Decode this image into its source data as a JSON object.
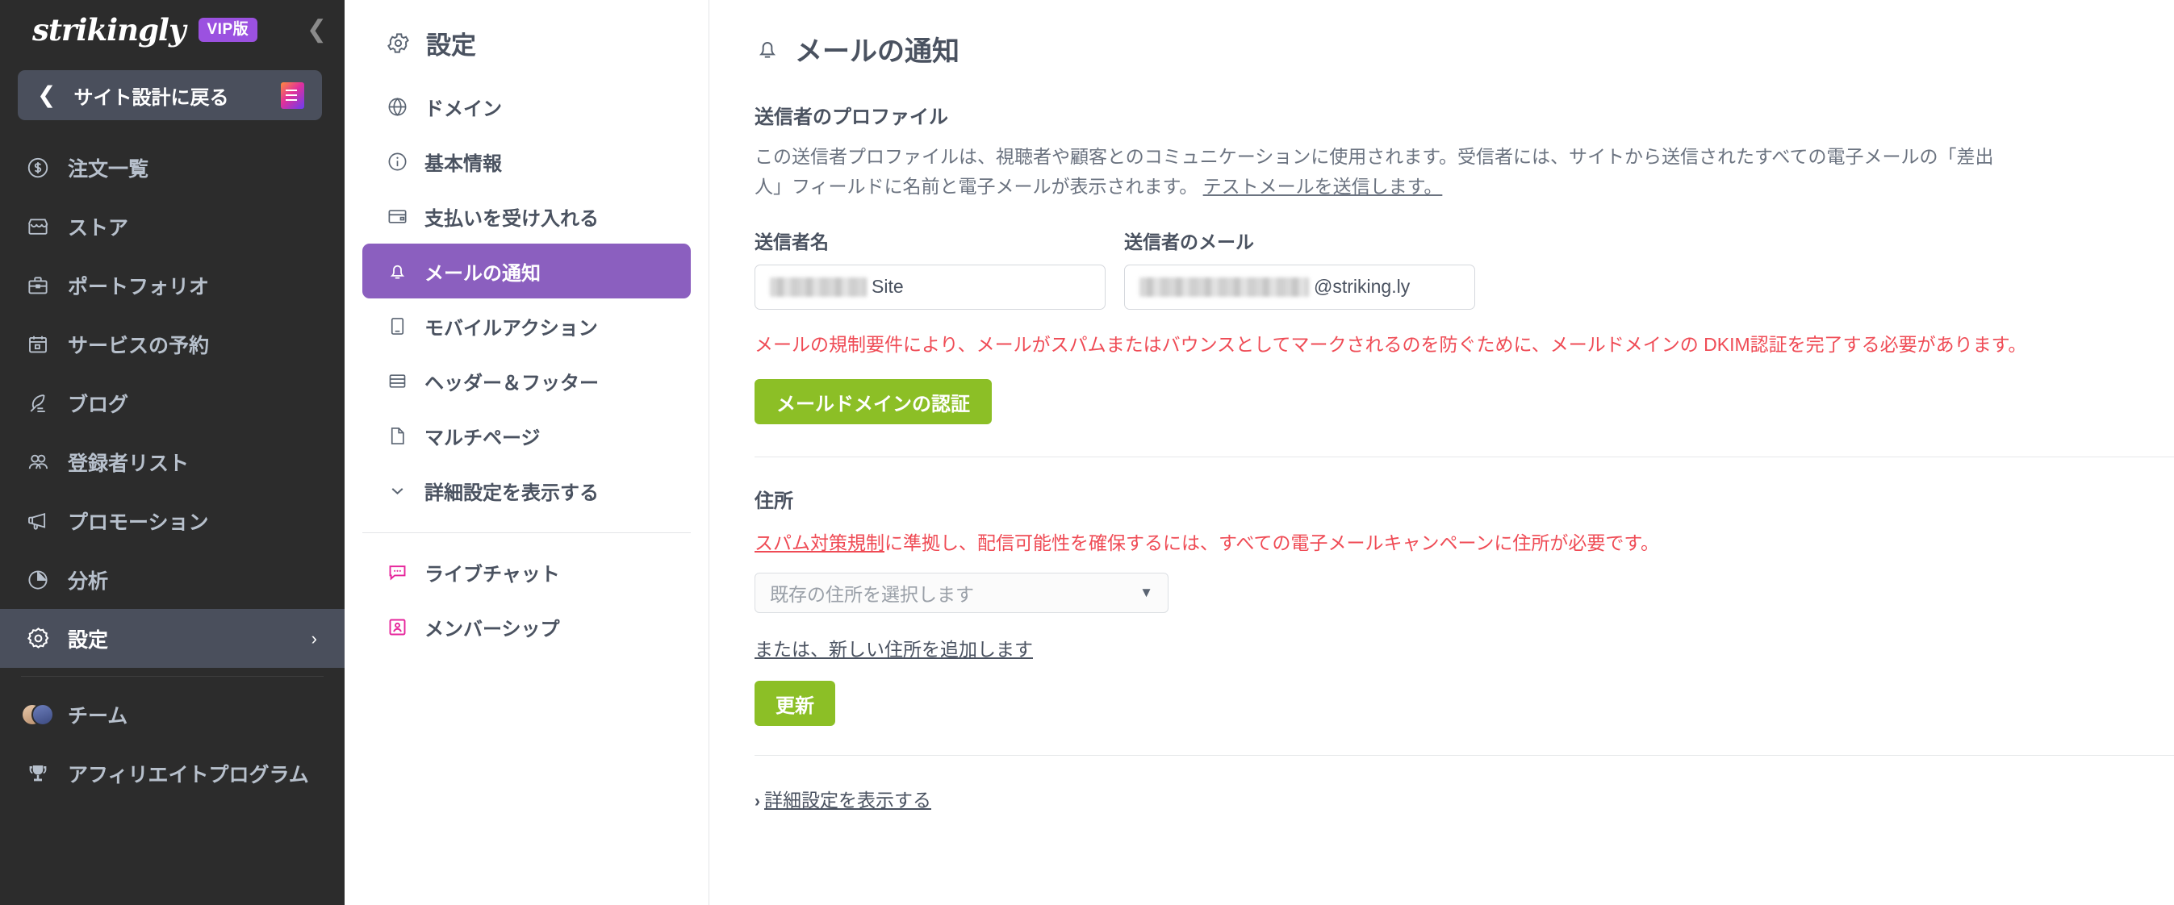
{
  "brand": {
    "logo": "strikingly",
    "badge": "VIP版",
    "collapse_icon": "chevron-left-icon"
  },
  "sidebar": {
    "back_button": {
      "label": "サイト設計に戻る",
      "chevron": "chevron-left-icon",
      "doc_icon": "document-icon"
    },
    "items": [
      {
        "label": "注文一覧",
        "icon": "dollar-circle-icon",
        "active": false
      },
      {
        "label": "ストア",
        "icon": "store-icon",
        "active": false
      },
      {
        "label": "ポートフォリオ",
        "icon": "briefcase-icon",
        "active": false
      },
      {
        "label": "サービスの予約",
        "icon": "calendar-icon",
        "active": false
      },
      {
        "label": "ブログ",
        "icon": "quill-icon",
        "active": false
      },
      {
        "label": "登録者リスト",
        "icon": "users-icon",
        "active": false
      },
      {
        "label": "プロモーション",
        "icon": "megaphone-icon",
        "active": false
      },
      {
        "label": "分析",
        "icon": "pie-chart-icon",
        "active": false
      },
      {
        "label": "設定",
        "icon": "gear-icon",
        "active": true,
        "arrow": "›"
      }
    ],
    "footer_items": [
      {
        "label": "チーム",
        "icon": "team-avatars-icon"
      },
      {
        "label": "アフィリエイトプログラム",
        "icon": "trophy-icon"
      }
    ]
  },
  "subnav": {
    "title": "設定",
    "title_icon": "gear-icon",
    "items": [
      {
        "label": "ドメイン",
        "icon": "globe-icon",
        "active": false
      },
      {
        "label": "基本情報",
        "icon": "info-circle-icon",
        "active": false
      },
      {
        "label": "支払いを受け入れる",
        "icon": "credit-card-icon",
        "active": false
      },
      {
        "label": "メールの通知",
        "icon": "bell-icon",
        "active": true
      },
      {
        "label": "モバイルアクション",
        "icon": "mobile-icon",
        "active": false
      },
      {
        "label": "ヘッダー＆フッター",
        "icon": "layout-rows-icon",
        "active": false
      },
      {
        "label": "マルチページ",
        "icon": "page-icon",
        "active": false
      },
      {
        "label": "詳細設定を表示する",
        "icon": "chevron-down-icon",
        "active": false
      }
    ],
    "extra_items": [
      {
        "label": "ライブチャット",
        "icon": "chat-bubble-icon"
      },
      {
        "label": "メンバーシップ",
        "icon": "member-card-icon"
      }
    ]
  },
  "main": {
    "title": "メールの通知",
    "title_icon": "bell-icon",
    "sender_profile": {
      "heading": "送信者のプロファイル",
      "description_line1": "この送信者プロファイルは、視聴者や顧客とのコミュニケーションに使用されます。受信者には、サイトから送信されたすべての電子メールの「差出",
      "description_line2": "人」フィールドに名前と電子メールが表示されます。",
      "test_mail_link": "テストメールを送信します。",
      "sender_name_label": "送信者名",
      "sender_name_value": "Site",
      "sender_email_label": "送信者のメール",
      "sender_email_value": "@striking.ly",
      "dkim_warning": "メールの規制要件により、メールがスパムまたはバウンスとしてマークされるのを防ぐために、メールドメインの DKIM認証を完了する必要があります。",
      "verify_button": "メールドメインの認証"
    },
    "address": {
      "heading": "住所",
      "warning_link": "スパム対策規制",
      "warning_rest": "に準拠し、配信可能性を確保するには、すべての電子メールキャンペーンに住所が必要です。",
      "select_placeholder": "既存の住所を選択します",
      "select_caret": "chevron-down-icon",
      "add_address_link": "または、新しい住所を追加します",
      "update_button": "更新"
    },
    "advanced_link": {
      "chevron": "›",
      "label": "詳細設定を表示する"
    }
  },
  "colors": {
    "sidebar_bg": "#2c2c2c",
    "sidebar_active": "#4a4f5c",
    "accent_purple": "#8b5fbf",
    "badge_purple": "#9b51e0",
    "green_button": "#8cbf26",
    "warning_red": "#ef4b55",
    "text_slate": "#4a5260"
  }
}
